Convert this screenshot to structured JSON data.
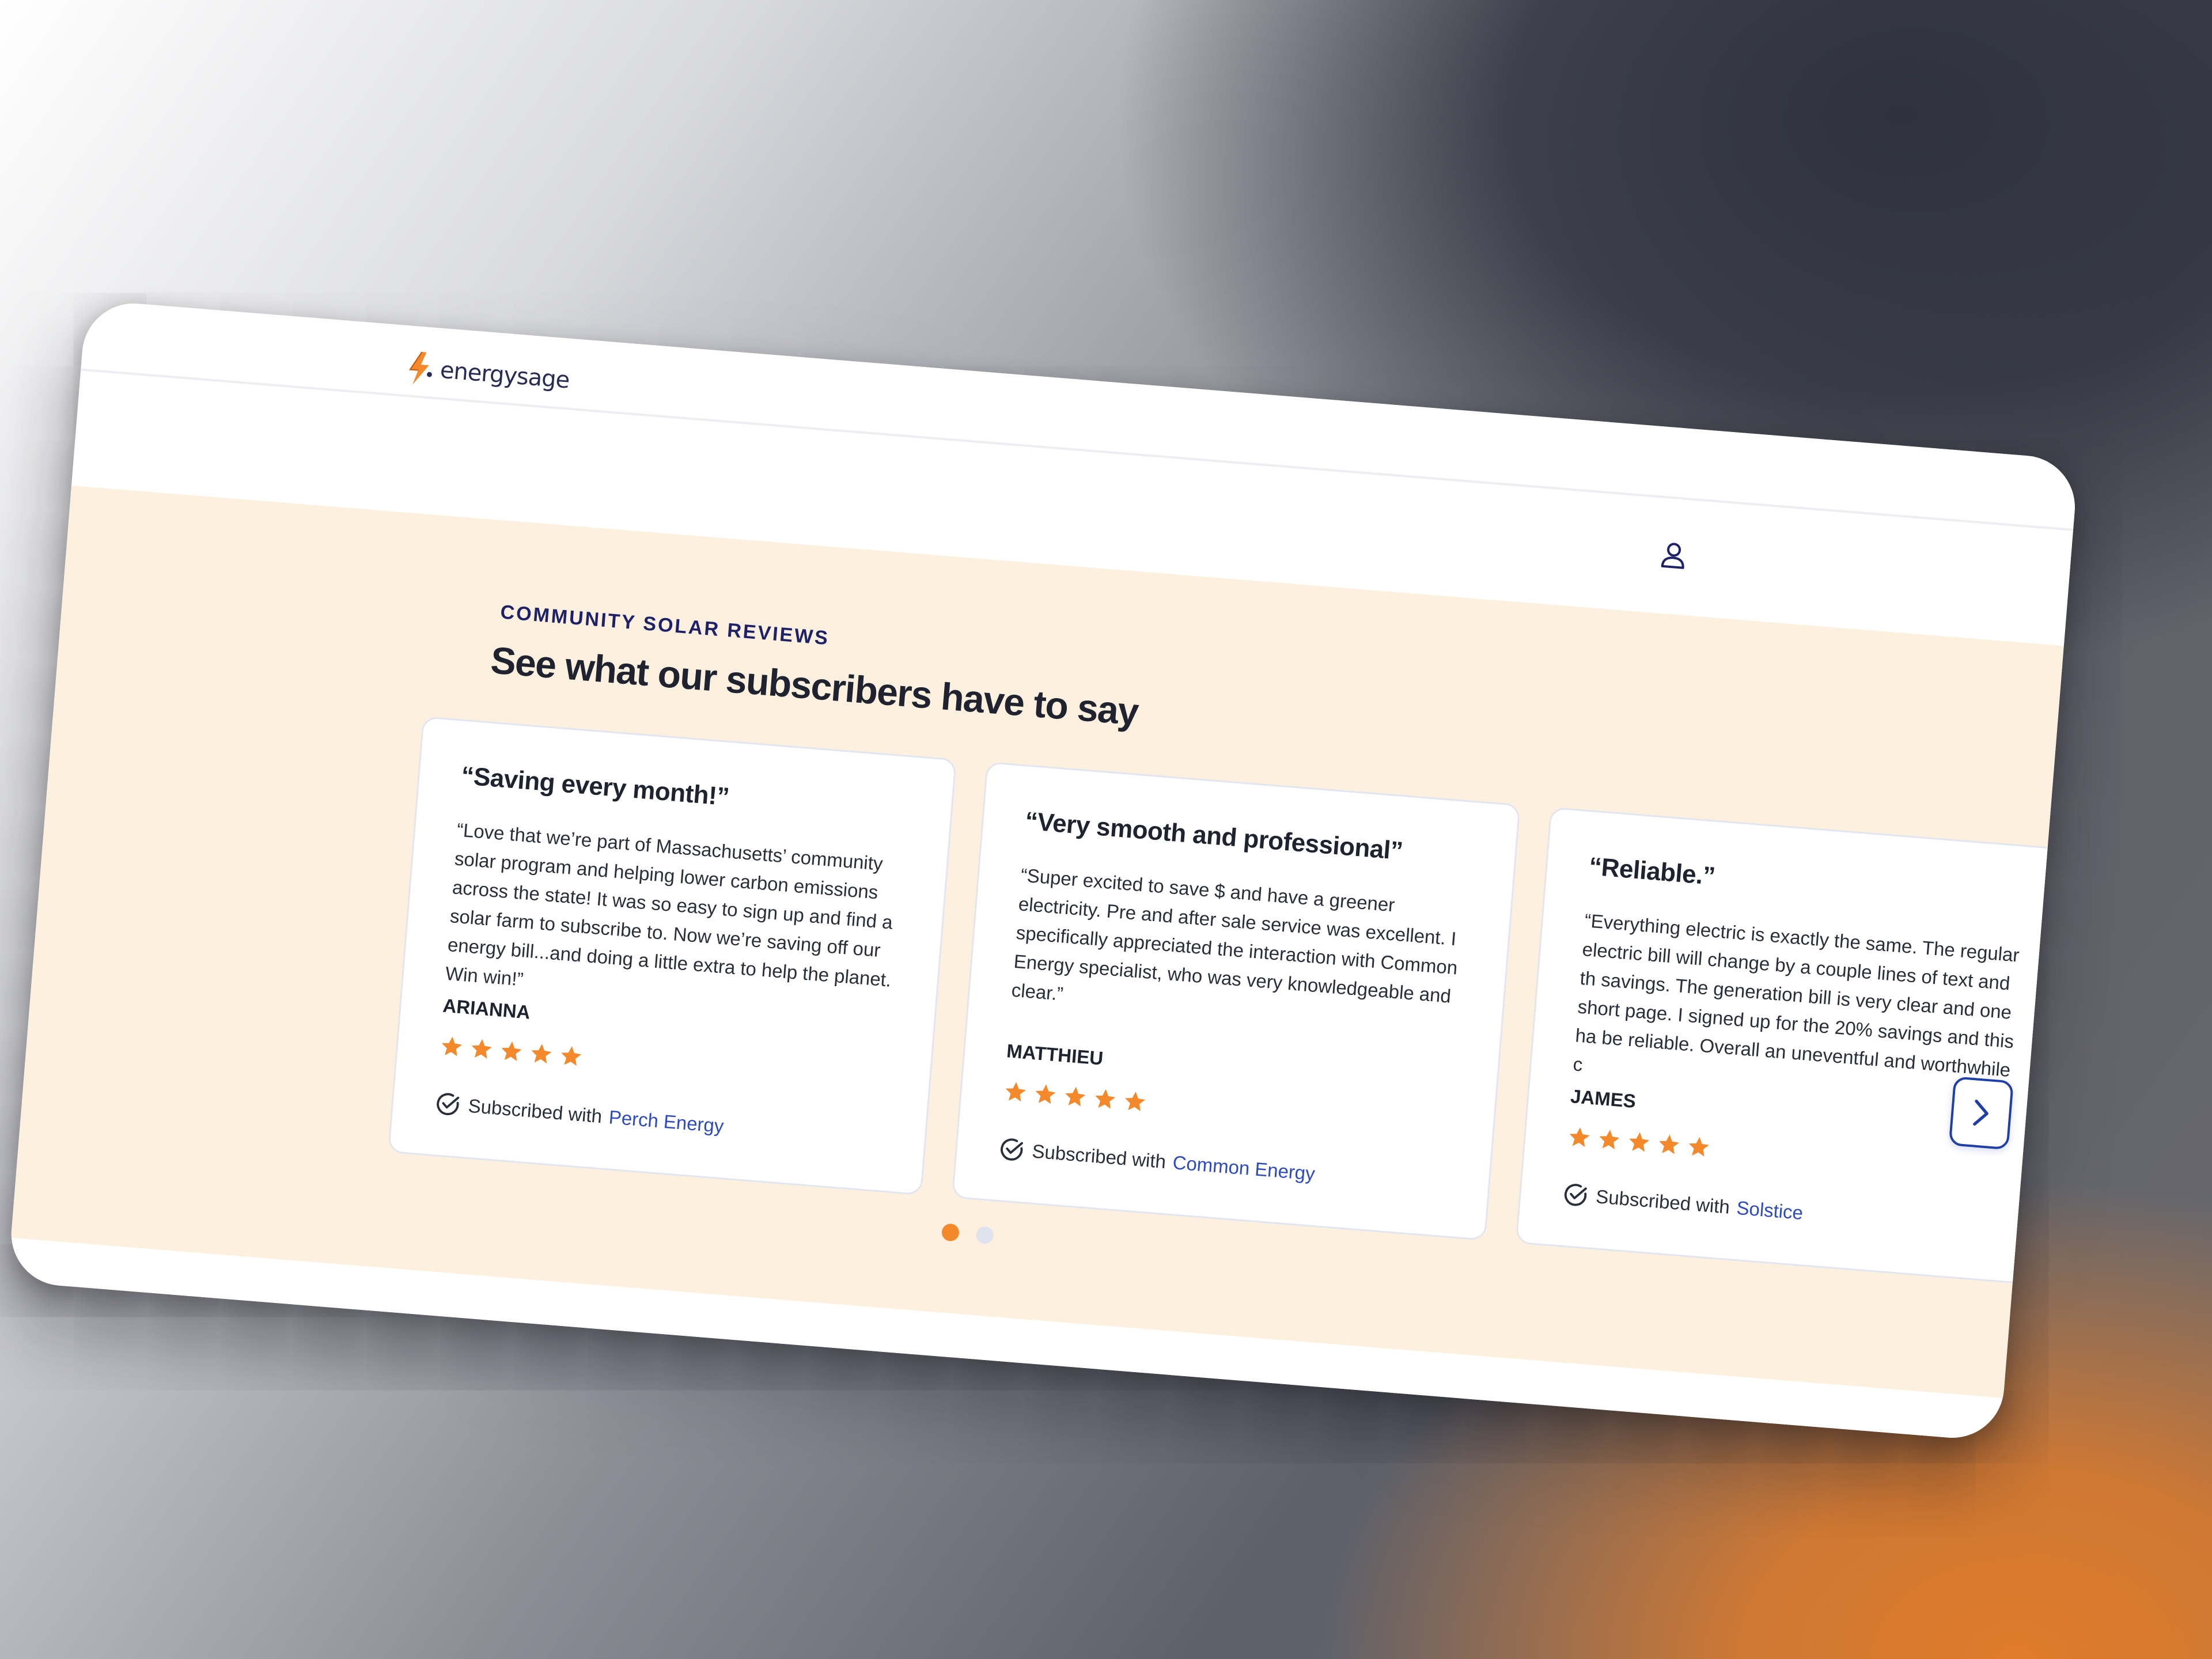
{
  "brand": {
    "name": "energysage",
    "accent": "#f4892b",
    "navy": "#1c2168",
    "link": "#2d4bbd"
  },
  "header": {
    "account_icon": "user-icon"
  },
  "section": {
    "eyebrow": "COMMUNITY SOLAR REVIEWS",
    "heading": "See what our subscribers have to say"
  },
  "reviews": [
    {
      "title": "“Saving every month!”",
      "quote": "“Love that we’re part of Massachusetts’ community solar program and helping lower carbon emissions across the state! It was so easy to sign up and find a solar farm to subscribe to. Now we’re saving off our energy bill...and doing a little extra to help the planet. Win win!”",
      "name": "ARIANNA",
      "rating": 5,
      "subscribed_label": "Subscribed with",
      "provider": "Perch Energy"
    },
    {
      "title": "“Very smooth and professional”",
      "quote": "“Super excited to save $ and have a greener electricity. Pre and after sale service was excellent. I specifically appreciated the interaction with Common Energy specialist, who was very knowledgeable and clear.”",
      "name": "MATTHIEU",
      "rating": 5,
      "subscribed_label": "Subscribed with",
      "provider": "Common Energy"
    },
    {
      "title": "“Reliable.”",
      "quote": "“Everything electric is exactly the same. The regular electric bill will change by a couple lines of text and th savings. The generation bill is very clear and one short page. I signed up for the 20% savings and this ha be reliable. Overall an uneventful and worthwhile c",
      "name": "JAMES",
      "rating": 5,
      "subscribed_label": "Subscribed with",
      "provider": "Solstice"
    }
  ],
  "carousel": {
    "pages": 2,
    "active_page": 1,
    "next_icon": "chevron-right-icon"
  }
}
